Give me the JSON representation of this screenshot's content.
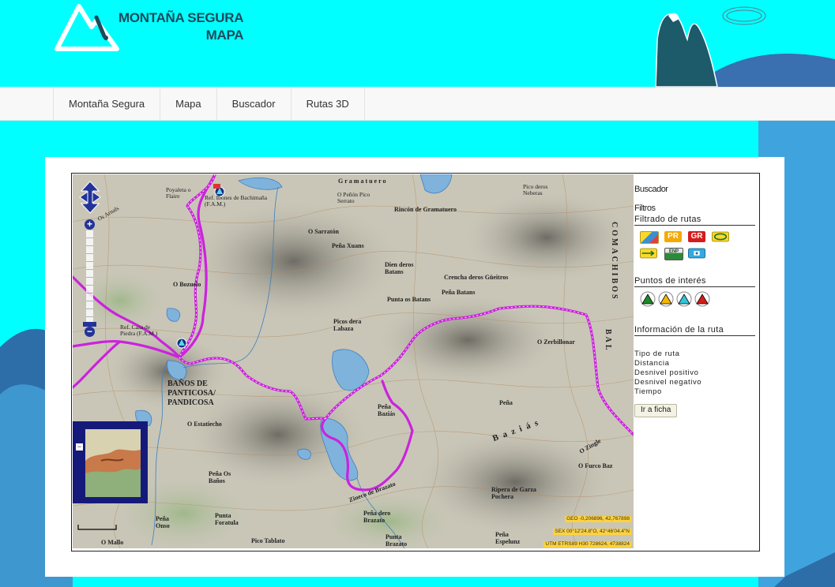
{
  "brand": {
    "line1": "MONTAÑA SEGURA",
    "line2": "MAPA"
  },
  "nav": [
    {
      "label": "Montaña Segura"
    },
    {
      "label": "Mapa"
    },
    {
      "label": "Buscador"
    },
    {
      "label": "Rutas 3D"
    }
  ],
  "sidebar": {
    "title": "Buscador",
    "filters": "Filtros",
    "route_filter_heading": "Filtrado de rutas",
    "route_icons": [
      "route-type-icon",
      "pr-badge-icon",
      "gr-badge-icon",
      "loop-route-icon",
      "linear-route-icon",
      "enp-badge-icon",
      "camera-icon"
    ],
    "pr_text": "PR",
    "gr_text": "GR",
    "enp_text": "ENP",
    "poi_heading": "Puntos de interés",
    "poi_icons": [
      "poi-green-icon",
      "poi-yellow-icon",
      "poi-cyan-icon",
      "poi-red-icon"
    ],
    "route_info_heading": "Información de la ruta",
    "info_fields": [
      "Tipo de ruta",
      "Distancia",
      "Desnivel positivo",
      "Desnivel negativo",
      "Tiempo"
    ],
    "button": "Ir a ficha"
  },
  "map": {
    "coord_geo": "GEO -0,206896, 42,767898",
    "coord_sex": "SEX 00°12'24.8\"O, 42°46'04.4\"N",
    "coord_utm": "UTM ETRS89 H30 728624, 4738824",
    "labels": {
      "gramatuero": "Gramatuero",
      "refugio_bachimana": "Ref. Ibones de Bachimaña (F.A.M.)",
      "rincon": "Rincón de Gramatuero",
      "o_sarrato": "O Sarratón",
      "pena_xuans": "Peña Xuans",
      "baths": "BAÑOS DE PANTICOSA/ PANDICOSA",
      "casa_piedra": "Ref. Casa de Piedra (F.A.M.)",
      "zerbillonar": "O Zerbillonar",
      "comachibos": "COMACHIBOS",
      "bal": "BAL",
      "crencha": "Crencha deros Güeitros",
      "pena_batans": "Peña Batans",
      "punta_batans": "Punta os Batans",
      "pena_baziás": "Peña Baziás",
      "ripera": "Ripera de Garza Pochera",
      "o_bozuelo": "O Bozuelo",
      "picos_labaza": "Picos dera Labaza",
      "o_estatiecho": "O Estatiecho",
      "pena_os_banos": "Peña Os Baños",
      "pena_oniso": "Peña Onso",
      "punta_foratula": "Punta Foratula",
      "pico_tablato": "Pico Tablato",
      "o_mallo": "O Mallo",
      "zineco": "Zineco de Brazato",
      "punta_brazato": "Punta Brazato",
      "pena_espelunz": "Peña Espelunz",
      "o_furco": "O Furco Baz",
      "baziás": "Baziás",
      "pico_neberas": "Pico deros Neberas",
      "o_penon": "O Peñón Pico Serrato",
      "dien_batans": "Dien deros Batans",
      "pena": "Peña",
      "o_zingle": "O Zingle",
      "pena_brazato": "Peña dero Brazato",
      "os_arnals": "Os Arnals",
      "poyaleta": "Poyaleta o Flaire"
    }
  }
}
